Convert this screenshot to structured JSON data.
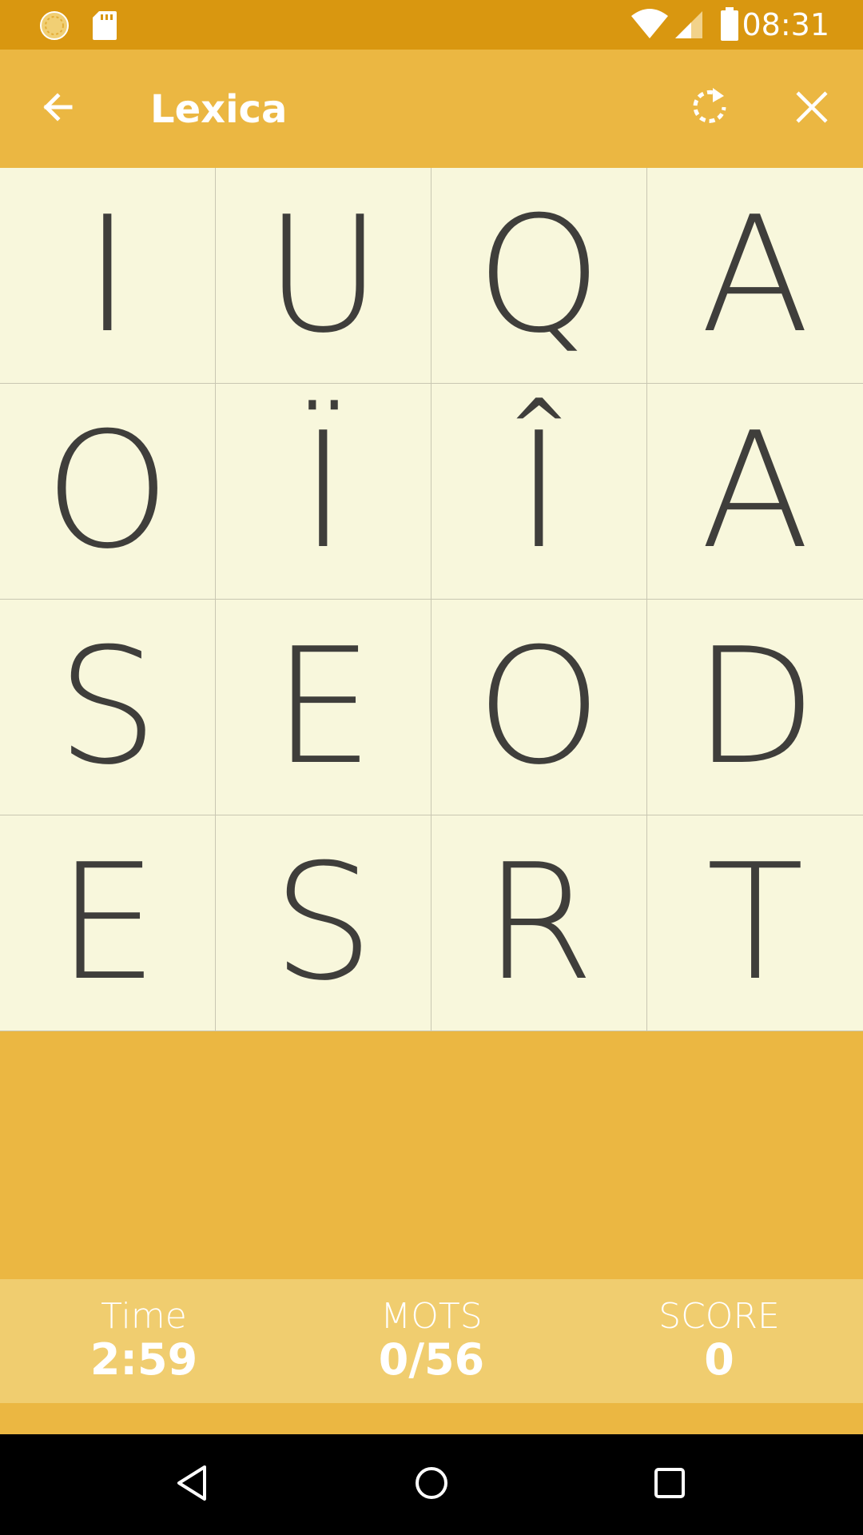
{
  "status_bar": {
    "time": "08:31",
    "icons": [
      "sync-status-icon",
      "sd-card-icon",
      "wifi-icon",
      "cellular-signal-icon",
      "battery-icon"
    ]
  },
  "app_bar": {
    "title": "Lexica",
    "back_icon": "arrow-back-icon",
    "rotate_icon": "rotate-icon",
    "close_icon": "close-icon"
  },
  "board": {
    "rows": [
      [
        "I",
        "U",
        "Q",
        "A"
      ],
      [
        "O",
        "Ï",
        "Î",
        "A"
      ],
      [
        "S",
        "E",
        "O",
        "D"
      ],
      [
        "E",
        "S",
        "R",
        "T"
      ]
    ]
  },
  "stats": {
    "time_label": "Time",
    "time_value": "2:59",
    "words_label": "MOTS",
    "words_value": "0/56",
    "score_label": "SCORE",
    "score_value": "0"
  },
  "nav_bar": {
    "icons": [
      "nav-back-icon",
      "nav-home-icon",
      "nav-recents-icon"
    ]
  },
  "colors": {
    "status_bar": "#d99710",
    "app_bar": "#ebb742",
    "board_bg": "#f8f7dc",
    "letter": "#3f3e3b",
    "score_panel": "#f0cd6f"
  }
}
